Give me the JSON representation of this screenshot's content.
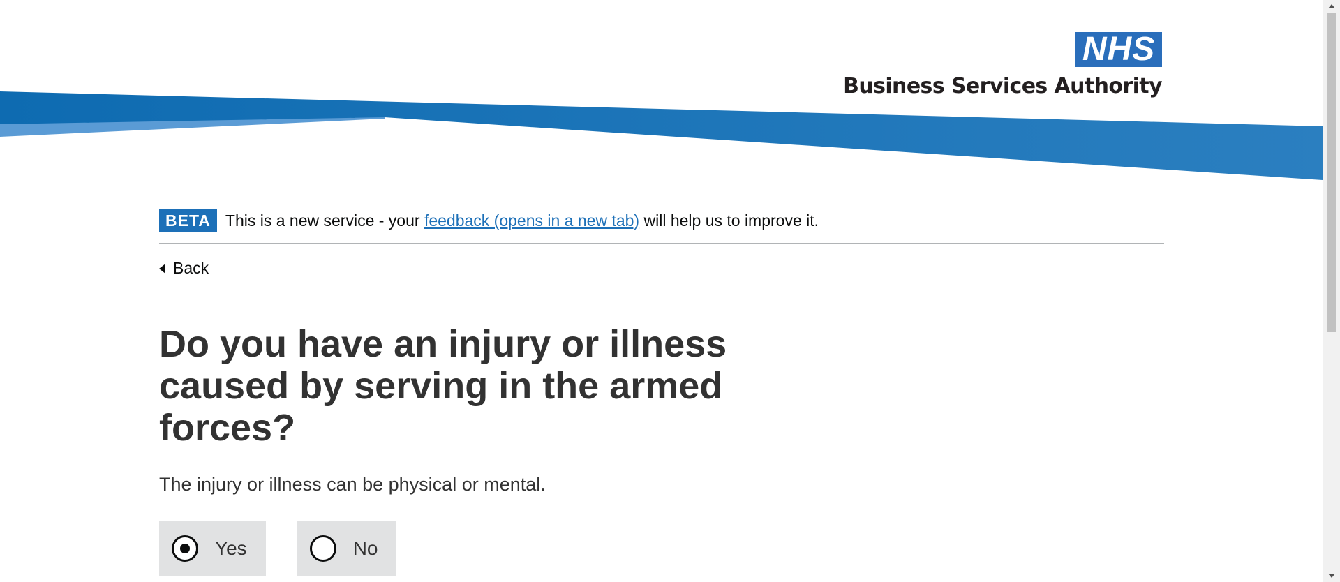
{
  "header": {
    "logo_mark": "NHS",
    "logo_text": "Business Services Authority",
    "brand_colors": {
      "band_dark": "#1a72b8",
      "band_light": "#5a9bd5",
      "logo_blue": "#2a6ebb"
    }
  },
  "phase_banner": {
    "tag": "BETA",
    "text_before": "This is a new service - your ",
    "link_text": "feedback (opens in a new tab)",
    "text_after": " will help us to improve it."
  },
  "back_link": {
    "label": "Back",
    "icon": "chevron-left-icon"
  },
  "question": {
    "heading": "Do you have an injury or illness caused by serving in the armed forces?",
    "hint": "The injury or illness can be physical or mental.",
    "options": [
      {
        "label": "Yes",
        "checked": true
      },
      {
        "label": "No",
        "checked": false
      }
    ]
  }
}
